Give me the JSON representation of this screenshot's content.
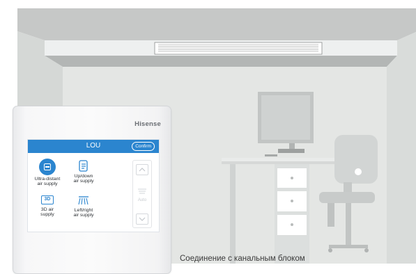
{
  "controller": {
    "brand": "Hisense",
    "screen_title": "LOU",
    "confirm_label": "Confirm",
    "options": [
      {
        "label": "Ultra-distant\nair supply",
        "icon": "ultra-distant-icon",
        "active": true
      },
      {
        "label": "Up/down\nair supply",
        "icon": "up-down-airflow-icon",
        "active": false
      },
      {
        "label": "3D air\nsupply",
        "icon": "3d-airflow-icon",
        "icon_text": "3D",
        "active": false
      },
      {
        "label": "Left/right\nair supply",
        "icon": "left-right-airflow-icon",
        "active": false
      }
    ],
    "side_panel": {
      "auto_label": "Auto"
    }
  },
  "caption": "Соединение с канальным блоком",
  "colors": {
    "accent": "#2b85cf",
    "wall": "#e4e6e4",
    "ceiling": "#c4c6c5"
  }
}
